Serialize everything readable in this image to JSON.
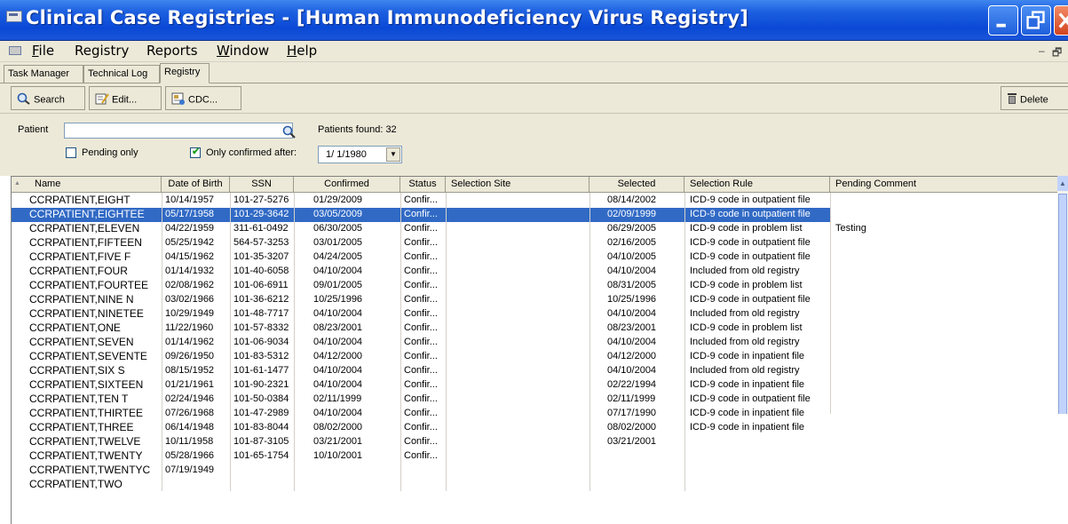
{
  "window": {
    "title": "Clinical Case Registries - [Human Immunodeficiency Virus Registry]"
  },
  "menu": {
    "items": [
      {
        "label": "File",
        "ul": "F",
        "rest": "ile"
      },
      {
        "label": "Registry",
        "ul": "",
        "rest": "Registry"
      },
      {
        "label": "Reports",
        "ul": "",
        "rest": "Reports"
      },
      {
        "label": "Window",
        "ul": "W",
        "rest": "indow"
      },
      {
        "label": "Help",
        "ul": "H",
        "rest": "elp"
      }
    ],
    "mdi_min": "–",
    "mdi_restore": "🗗"
  },
  "tabs": [
    {
      "label": "Task Manager"
    },
    {
      "label": "Technical Log"
    },
    {
      "label": "Registry"
    }
  ],
  "toolbar": {
    "search": "Search",
    "edit": "Edit...",
    "cdc": "CDC...",
    "delete": "Delete"
  },
  "filter": {
    "patient_label": "Patient",
    "patient_value": "",
    "patients_found": "Patients found: 32",
    "pending_only": "Pending only",
    "only_confirmed_after": "Only confirmed after:",
    "date": "1/ 1/1980"
  },
  "grid": {
    "columns": [
      "Name",
      "Date of Birth",
      "SSN",
      "Confirmed",
      "Status",
      "Selection Site",
      "Selected",
      "Selection Rule",
      "Pending Comment"
    ],
    "rows": [
      [
        "CCRPATIENT,EIGHT",
        "10/14/1957",
        "101-27-5276",
        "01/29/2009",
        "Confir...",
        "",
        "08/14/2002",
        "ICD-9 code in outpatient file",
        ""
      ],
      [
        "CCRPATIENT,EIGHTEE",
        "05/17/1958",
        "101-29-3642",
        "03/05/2009",
        "Confir...",
        "",
        "02/09/1999",
        "ICD-9 code in outpatient file",
        ""
      ],
      [
        "CCRPATIENT,ELEVEN",
        "04/22/1959",
        "311-61-0492",
        "06/30/2005",
        "Confir...",
        "",
        "06/29/2005",
        "ICD-9 code in problem list",
        "Testing"
      ],
      [
        "CCRPATIENT,FIFTEEN",
        "05/25/1942",
        "564-57-3253",
        "03/01/2005",
        "Confir...",
        "",
        "02/16/2005",
        "ICD-9 code in outpatient file",
        ""
      ],
      [
        "CCRPATIENT,FIVE F",
        "04/15/1962",
        "101-35-3207",
        "04/24/2005",
        "Confir...",
        "",
        "04/10/2005",
        "ICD-9 code in outpatient file",
        ""
      ],
      [
        "CCRPATIENT,FOUR",
        "01/14/1932",
        "101-40-6058",
        "04/10/2004",
        "Confir...",
        "",
        "04/10/2004",
        "Included from old registry",
        ""
      ],
      [
        "CCRPATIENT,FOURTEE",
        "02/08/1962",
        "101-06-6911",
        "09/01/2005",
        "Confir...",
        "",
        "08/31/2005",
        "ICD-9 code in problem list",
        ""
      ],
      [
        "CCRPATIENT,NINE N",
        "03/02/1966",
        "101-36-6212",
        "10/25/1996",
        "Confir...",
        "",
        "10/25/1996",
        "ICD-9 code in outpatient file",
        ""
      ],
      [
        "CCRPATIENT,NINETEE",
        "10/29/1949",
        "101-48-7717",
        "04/10/2004",
        "Confir...",
        "",
        "04/10/2004",
        "Included from old registry",
        ""
      ],
      [
        "CCRPATIENT,ONE",
        "11/22/1960",
        "101-57-8332",
        "08/23/2001",
        "Confir...",
        "",
        "08/23/2001",
        "ICD-9 code in problem list",
        ""
      ],
      [
        "CCRPATIENT,SEVEN",
        "01/14/1962",
        "101-06-9034",
        "04/10/2004",
        "Confir...",
        "",
        "04/10/2004",
        "Included from old registry",
        ""
      ],
      [
        "CCRPATIENT,SEVENTE",
        "09/26/1950",
        "101-83-5312",
        "04/12/2000",
        "Confir...",
        "",
        "04/12/2000",
        "ICD-9 code in inpatient file",
        ""
      ],
      [
        "CCRPATIENT,SIX S",
        "08/15/1952",
        "101-61-1477",
        "04/10/2004",
        "Confir...",
        "",
        "04/10/2004",
        "Included from old registry",
        ""
      ],
      [
        "CCRPATIENT,SIXTEEN",
        "01/21/1961",
        "101-90-2321",
        "04/10/2004",
        "Confir...",
        "",
        "02/22/1994",
        "ICD-9 code in inpatient file",
        ""
      ],
      [
        "CCRPATIENT,TEN T",
        "02/24/1946",
        "101-50-0384",
        "02/11/1999",
        "Confir...",
        "",
        "02/11/1999",
        "ICD-9 code in outpatient file",
        ""
      ],
      [
        "CCRPATIENT,THIRTEE",
        "07/26/1968",
        "101-47-2989",
        "04/10/2004",
        "Confir...",
        "",
        "07/17/1990",
        "ICD-9 code in inpatient file",
        ""
      ],
      [
        "CCRPATIENT,THREE",
        "06/14/1948",
        "101-83-8044",
        "08/02/2000",
        "Confir...",
        "",
        "08/02/2000",
        "ICD-9 code in inpatient file",
        ""
      ],
      [
        "CCRPATIENT,TWELVE",
        "10/11/1958",
        "101-87-3105",
        "03/21/2001",
        "Confir...",
        "",
        "03/21/2001",
        "",
        ""
      ],
      [
        "CCRPATIENT,TWENTY",
        "05/28/1966",
        "101-65-1754",
        "10/10/2001",
        "Confir...",
        "",
        "",
        "",
        ""
      ],
      [
        "CCRPATIENT,TWENTYC",
        "07/19/1949",
        "",
        "",
        "",
        "",
        "",
        "",
        ""
      ],
      [
        "CCRPATIENT,TWO",
        "",
        "",
        "",
        "",
        "",
        "",
        "",
        ""
      ]
    ],
    "selected_row": 1
  },
  "colors": {
    "titlebar": "#0a49d6",
    "selection": "#316ac5",
    "chrome": "#ece9d8"
  },
  "icons": [
    "app-icon",
    "mdi-icon",
    "minimize-icon",
    "restore-icon",
    "close-icon",
    "search-icon",
    "edit-icon",
    "cdc-icon",
    "delete-icon",
    "magnifier-icon",
    "chevron-down-icon",
    "sort-icon"
  ]
}
